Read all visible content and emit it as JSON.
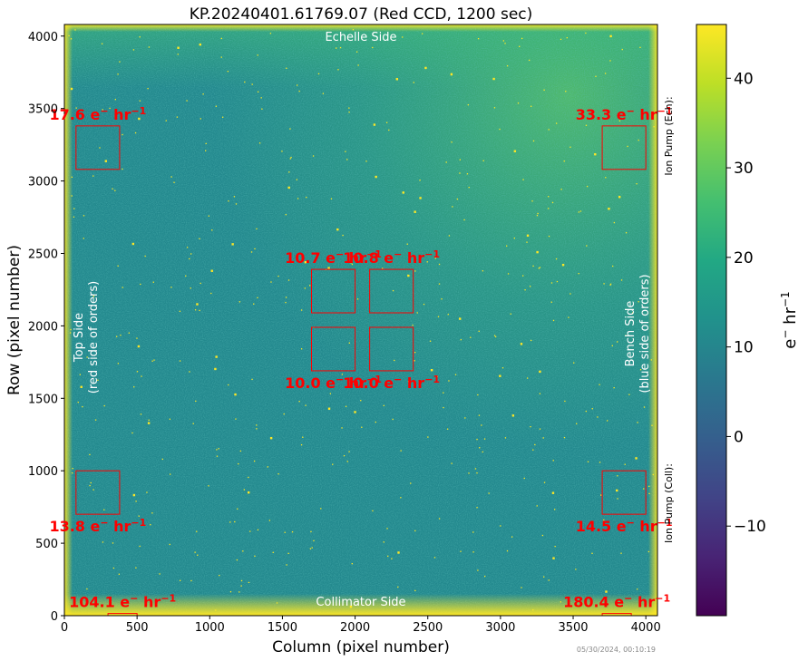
{
  "chart_data": {
    "type": "heatmap",
    "title": "KP.20240401.61769.07 (Red CCD, 1200 sec)",
    "xlabel": "Column (pixel number)",
    "ylabel": "Row (pixel number)",
    "xlim": [
      0,
      4080
    ],
    "ylim": [
      0,
      4080
    ],
    "xticks": [
      0,
      500,
      1000,
      1500,
      2000,
      2500,
      3000,
      3500,
      4000
    ],
    "yticks": [
      0,
      500,
      1000,
      1500,
      2000,
      2500,
      3000,
      3500,
      4000
    ],
    "colorbar": {
      "label_base": "e",
      "label_sup1": "−",
      "label_mid": " hr",
      "label_sup2": "−1",
      "range": [
        -20,
        46
      ],
      "colormap": "viridis",
      "ticks": [
        -10,
        0,
        10,
        20,
        30,
        40
      ],
      "tick_labels": [
        "−10",
        "0",
        "10",
        "20",
        "30",
        "40"
      ]
    },
    "regions": [
      {
        "x0": 80,
        "x1": 380,
        "y0": 3080,
        "y1": 3380,
        "value": "17.6",
        "label_pos": "above"
      },
      {
        "x0": 3700,
        "x1": 4000,
        "y0": 3080,
        "y1": 3380,
        "value": "33.3",
        "label_pos": "above"
      },
      {
        "x0": 1700,
        "x1": 2000,
        "y0": 2090,
        "y1": 2390,
        "value": "10.7",
        "label_pos": "above"
      },
      {
        "x0": 2100,
        "x1": 2400,
        "y0": 2090,
        "y1": 2390,
        "value": "10.8",
        "label_pos": "above"
      },
      {
        "x0": 1700,
        "x1": 2000,
        "y0": 1690,
        "y1": 1990,
        "value": "10.0",
        "label_pos": "below"
      },
      {
        "x0": 2100,
        "x1": 2400,
        "y0": 1690,
        "y1": 1990,
        "value": "10.0",
        "label_pos": "below"
      },
      {
        "x0": 80,
        "x1": 380,
        "y0": 700,
        "y1": 1000,
        "value": "13.8",
        "label_pos": "below"
      },
      {
        "x0": 3700,
        "x1": 4000,
        "y0": 700,
        "y1": 1000,
        "value": "14.5",
        "label_pos": "below"
      },
      {
        "x0": 300,
        "x1": 500,
        "y0": 0,
        "y1": 15,
        "value": "104.1",
        "label_pos": "above"
      },
      {
        "x0": 3700,
        "x1": 3900,
        "y0": 0,
        "y1": 15,
        "value": "180.4",
        "label_pos": "above"
      }
    ],
    "region_unit": {
      "base": " e",
      "sup1": "−",
      "mid": " hr",
      "sup2": "−1"
    },
    "annotations": {
      "top": "Echelle Side",
      "bottom": "Collimator Side",
      "left_line1": "Top Side",
      "left_line2": "(red side of orders)",
      "right_line1": "Bench Side",
      "right_line2": "(blue side of orders)",
      "ion_pump_top": "Ion Pump (Ech):",
      "ion_pump_bottom": "Ion Pump (Coll):",
      "timestamp": "05/30/2024, 00:10:19"
    },
    "grid": false,
    "colors": {
      "annotation_text": "#ffffff",
      "region_box": "#ff0000",
      "region_label": "#ff0000",
      "axis": "#000000"
    }
  }
}
